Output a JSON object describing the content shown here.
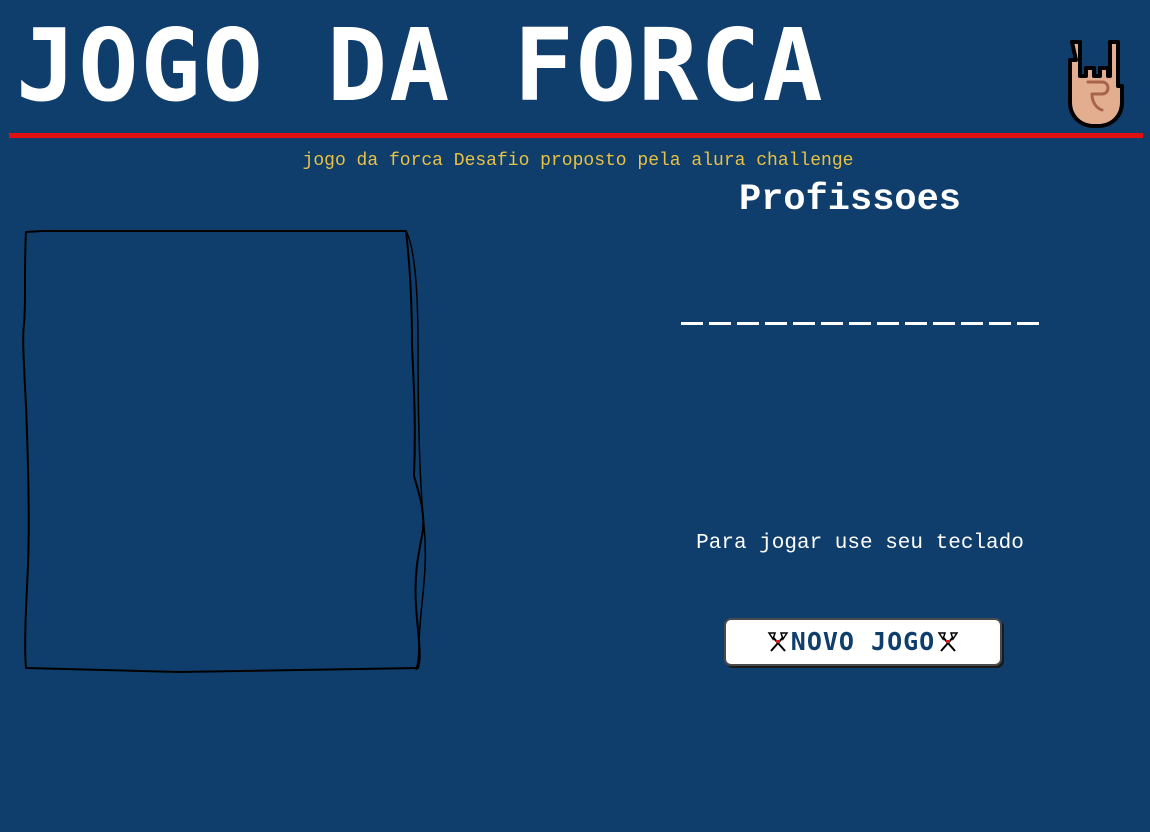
{
  "header": {
    "title": "JOGO DA FORCA",
    "icon": "rock-hand-icon"
  },
  "subtitle": "jogo da forca Desafio proposto pela alura challenge",
  "game": {
    "category": "Profissoes",
    "word_length": 13,
    "instructions": "Para jogar use seu teclado",
    "new_game_label": "NOVO JOGO",
    "button_icon": "crossed-axes-icon"
  },
  "colors": {
    "background": "#0f3e6c",
    "accent_line": "#e01010",
    "subtitle": "#e8c243",
    "text": "#ffffff"
  }
}
